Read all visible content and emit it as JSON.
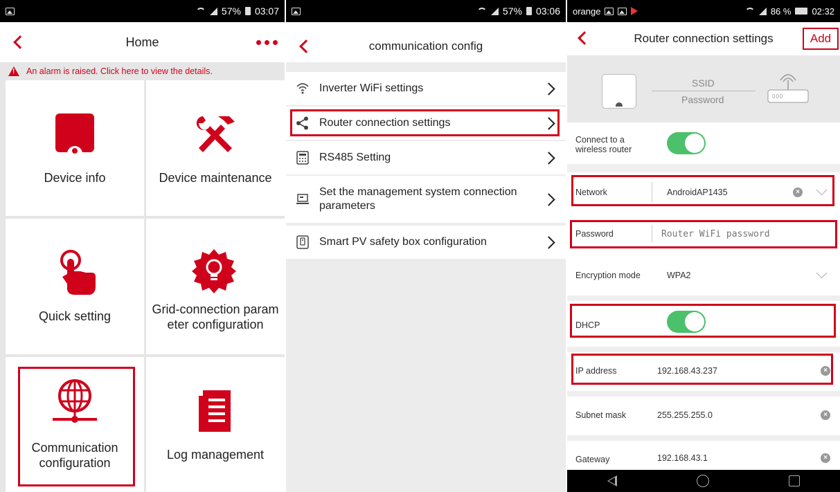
{
  "screen1": {
    "status": {
      "battery": "57%",
      "time": "03:07"
    },
    "title": "Home",
    "alarm": "An alarm is raised. Click here to view the details.",
    "tiles": [
      {
        "label": "Device info",
        "icon": "device-icon"
      },
      {
        "label": "Device maintenance",
        "icon": "tools-icon"
      },
      {
        "label": "Quick setting",
        "icon": "tap-icon"
      },
      {
        "label": "Grid-connection param eter configuration",
        "icon": "bulb-icon"
      },
      {
        "label": "Communication configuration",
        "icon": "globe-icon"
      },
      {
        "label": "Log management",
        "icon": "log-icon"
      }
    ]
  },
  "screen2": {
    "status": {
      "battery": "57%",
      "time": "03:06"
    },
    "title": "communication config",
    "items": [
      {
        "label": "Inverter WiFi settings",
        "icon": "wifi-icon"
      },
      {
        "label": "Router connection settings",
        "icon": "share-icon"
      },
      {
        "label": "RS485 Setting",
        "icon": "calculator-icon"
      },
      {
        "label": "Set the management system connection parameters",
        "icon": "laptop-icon"
      },
      {
        "label": "Smart PV safety box configuration",
        "icon": "safety-box-icon"
      }
    ]
  },
  "screen3": {
    "status": {
      "carrier": "orange",
      "signal": "86 %",
      "time": "02:32"
    },
    "title": "Router connection settings",
    "add_label": "Add",
    "diagram": {
      "ssid": "SSID",
      "password": "Password",
      "router_dots": "000"
    },
    "connect_label": "Connect to a wireless router",
    "network": {
      "label": "Network",
      "value": "AndroidAP1435"
    },
    "password": {
      "label": "Password",
      "placeholder": "Router WiFi password"
    },
    "encryption": {
      "label": "Encryption mode",
      "value": "WPA2"
    },
    "dhcp": {
      "label": "DHCP"
    },
    "ip": {
      "label": "IP address",
      "value": "192.168.43.237"
    },
    "subnet": {
      "label": "Subnet mask",
      "value": "255.255.255.0"
    },
    "gateway": {
      "label": "Gateway",
      "value": "192.168.43.1"
    }
  },
  "colors": {
    "accent": "#d0021b",
    "toggle_on": "#4cc06a"
  }
}
